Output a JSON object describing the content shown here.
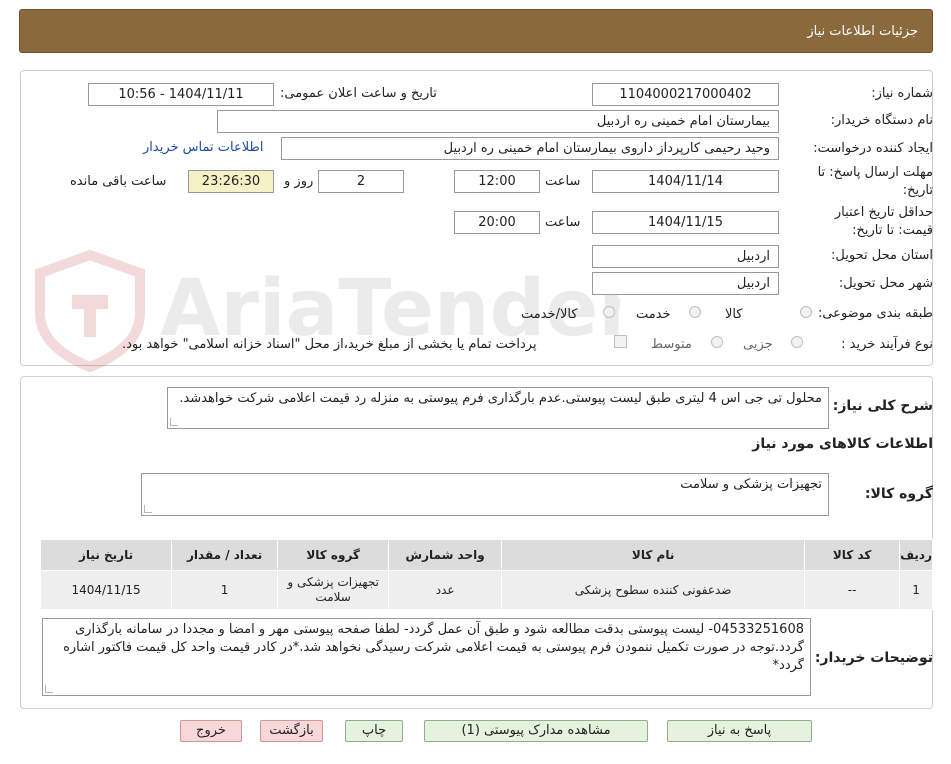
{
  "header": {
    "title": "جزئیات اطلاعات نیاز"
  },
  "watermark": {
    "text": "AriaTender.neT"
  },
  "form": {
    "need_number_label": "شماره نیاز:",
    "need_number": "1104000217000402",
    "announce_label": "تاریخ و ساعت اعلان عمومی:",
    "announce_value": "1404/11/11 - 10:56",
    "buyer_org_label": "نام دستگاه خریدار:",
    "buyer_org": "بیمارستان امام خمینی  ره  اردبیل",
    "creator_label": "ایجاد کننده درخواست:",
    "creator": "وحید رحیمی کارپرداز داروی  بیمارستان امام خمینی  ره  اردبیل",
    "contact_link": "اطلاعات تماس خریدار",
    "reply_deadline_label_1": "مهلت ارسال پاسخ: تا",
    "reply_deadline_label_2": "تاریخ:",
    "reply_date": "1404/11/14",
    "time_label": "ساعت",
    "reply_time": "12:00",
    "days_value": "2",
    "days_label": "روز و",
    "remaining_time": "23:26:30",
    "remaining_label": "ساعت باقی مانده",
    "validity_label_1": "حداقل تاریخ اعتبار",
    "validity_label_2": "قیمت: تا تاریخ:",
    "validity_date": "1404/11/15",
    "validity_time_label": "ساعت",
    "validity_time": "20:00",
    "province_label": "استان محل تحویل:",
    "province": "اردبیل",
    "city_label": "شهر محل تحویل:",
    "city": "اردبیل",
    "category_label": "طبقه بندی موضوعی:",
    "category_options": [
      "کالا",
      "خدمت",
      "کالا/خدمت"
    ],
    "process_label": "نوع فرآیند خرید :",
    "process_options": [
      "جزیی",
      "متوسط"
    ],
    "payment_note": "پرداخت تمام یا بخشی از مبلغ خرید،از محل \"اسناد خزانه اسلامی\" خواهد بود."
  },
  "summary": {
    "label": "شرح کلی نیاز:",
    "text": "محلول تی جی اس  4 لیتری طبق لیست پیوستی.عدم بارگذاری فرم پیوستی به منزله رد قیمت اعلامی شرکت خواهدشد.",
    "goods_info_title": "اطلاعات کالاهای مورد نیاز",
    "goods_group_label": "گروه کالا:",
    "goods_group": "تجهیزات پزشکی و سلامت"
  },
  "table": {
    "headers": [
      "ردیف",
      "کد کالا",
      "نام کالا",
      "واحد شمارش",
      "گروه کالا",
      "تعداد / مقدار",
      "تاریخ نیاز"
    ],
    "rows": [
      [
        "1",
        "--",
        "ضدعفونی کننده سطوح پزشکی",
        "عدد",
        "تجهیزات پزشکی و سلامت",
        "1",
        "1404/11/15"
      ]
    ]
  },
  "buyer_notes": {
    "label": "توضیحات خریدار:",
    "text": "04533251608- لیست پیوستی بدقت مطالعه شود و طبق آن عمل گردد- لطفا صفحه پیوستی مهر و امضا و مجددا در سامانه بارگذاری گردد.توجه در صورت تکمیل ننمودن فرم پیوستی به قیمت اعلامی شرکت رسیدگی نخواهد شد.*در کادر قیمت واحد کل قیمت فاکتور اشاره گردد*"
  },
  "buttons": {
    "reply": "پاسخ به نیاز",
    "attachments": "مشاهده مدارک پیوستی (1)",
    "print": "چاپ",
    "back": "بازگشت",
    "exit": "خروج"
  }
}
